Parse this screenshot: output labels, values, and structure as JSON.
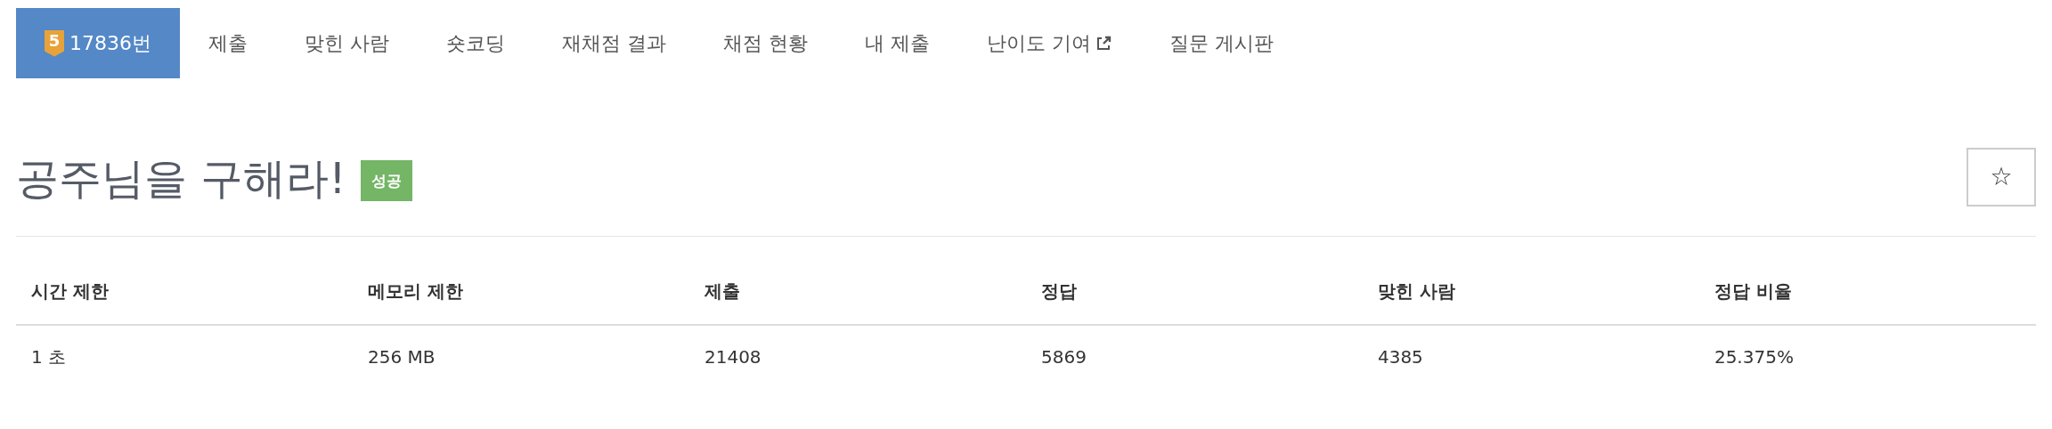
{
  "tabs": [
    {
      "label": "17836번",
      "selected": true,
      "tier": "5",
      "external": false
    },
    {
      "label": "제출",
      "selected": false,
      "external": false
    },
    {
      "label": "맞힌 사람",
      "selected": false,
      "external": false
    },
    {
      "label": "숏코딩",
      "selected": false,
      "external": false
    },
    {
      "label": "재채점 결과",
      "selected": false,
      "external": false
    },
    {
      "label": "채점 현황",
      "selected": false,
      "external": false
    },
    {
      "label": "내 제출",
      "selected": false,
      "external": false
    },
    {
      "label": "난이도 기여",
      "selected": false,
      "external": true
    },
    {
      "label": "질문 게시판",
      "selected": false,
      "external": false
    }
  ],
  "problem": {
    "title": "공주님을 구해라!",
    "result_badge": "성공",
    "star_button": "☆"
  },
  "info_table": {
    "columns": [
      "시간 제한",
      "메모리 제한",
      "제출",
      "정답",
      "맞힌 사람",
      "정답 비율"
    ],
    "rows": [
      [
        "1 초",
        "256 MB",
        "21408",
        "5869",
        "4385",
        "25.375%"
      ]
    ]
  }
}
